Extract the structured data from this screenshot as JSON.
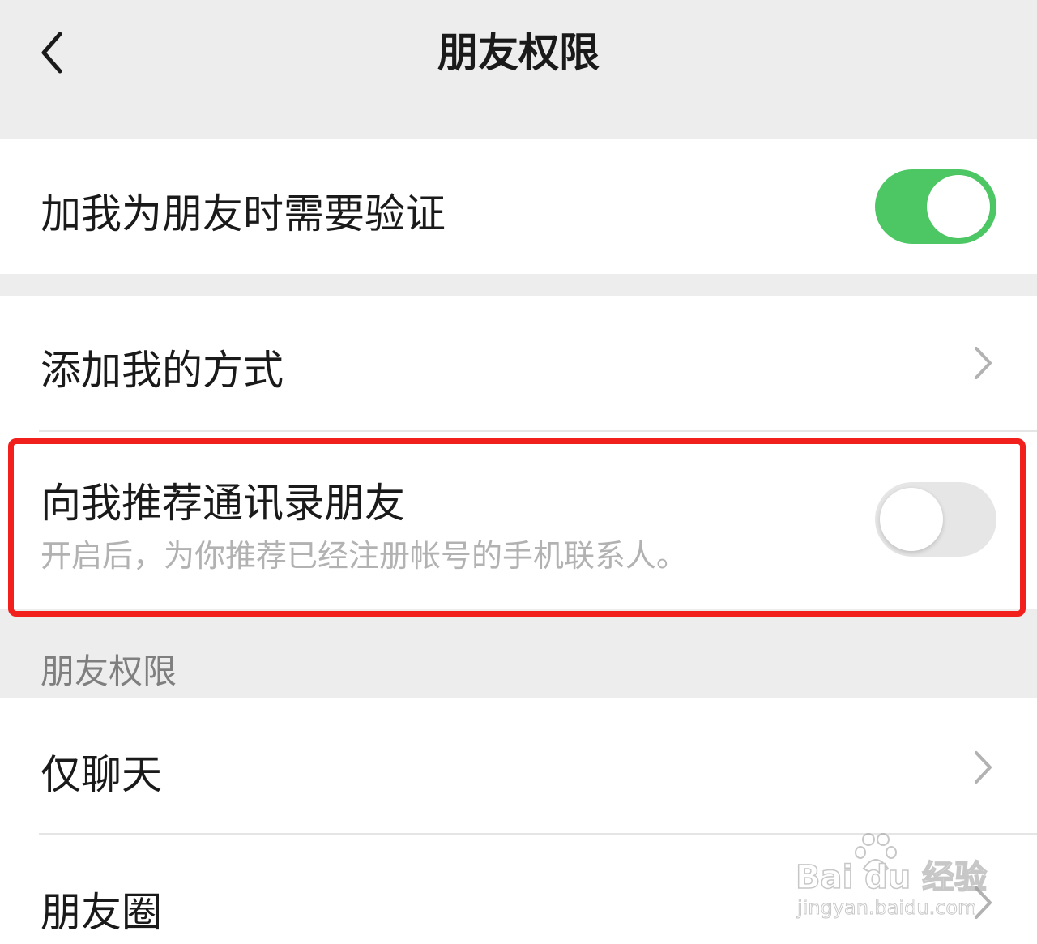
{
  "header": {
    "title": "朋友权限"
  },
  "settings": {
    "verify": {
      "label": "加我为朋友时需要验证",
      "enabled": true
    },
    "add_methods": {
      "label": "添加我的方式"
    },
    "recommend_contacts": {
      "label": "向我推荐通讯录朋友",
      "description": "开启后，为你推荐已经注册帐号的手机联系人。",
      "enabled": false
    }
  },
  "friend_permissions": {
    "section_label": "朋友权限",
    "items": [
      {
        "label": "仅聊天"
      },
      {
        "label": "朋友圈"
      }
    ]
  },
  "watermark": {
    "brand": "Bai du 经验",
    "url": "jingyan.baidu.com"
  },
  "colors": {
    "toggle_on": "#4cc763",
    "toggle_off": "#e6e6e6",
    "highlight": "#f2201c",
    "background": "#ededed"
  }
}
